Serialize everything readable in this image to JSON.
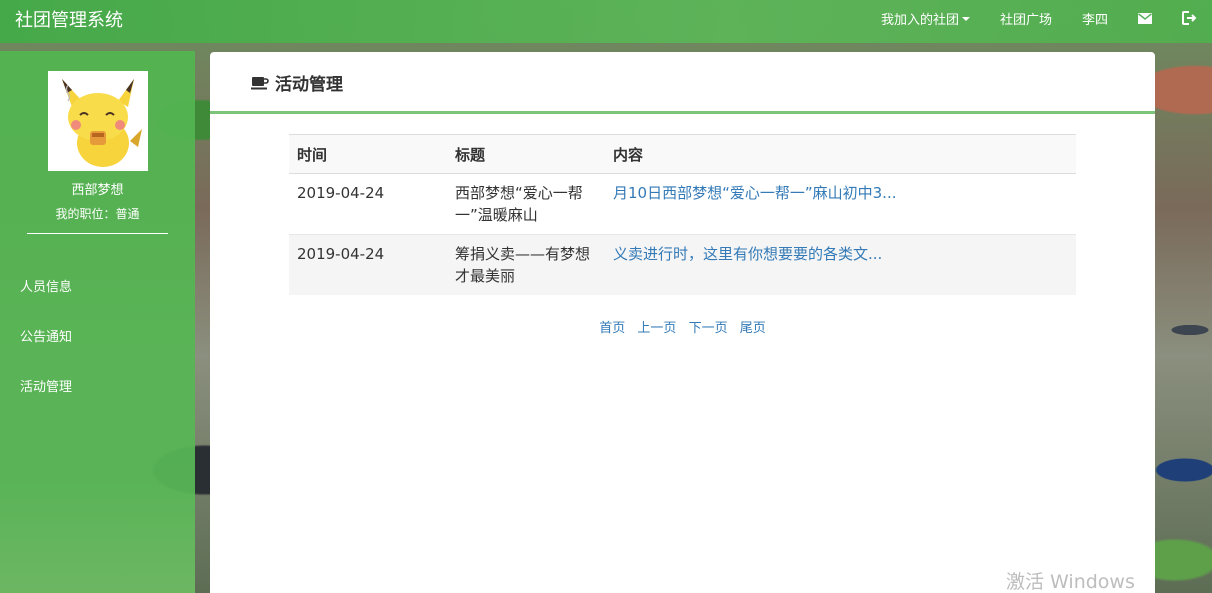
{
  "app": {
    "title": "社团管理系统"
  },
  "topnav": {
    "my_clubs_label": "我加入的社团",
    "club_square_label": "社团广场",
    "user_name": "李四",
    "mail_icon": "envelope-icon",
    "logout_icon": "logout-icon"
  },
  "sidebar": {
    "profile_name": "西部梦想",
    "profile_role": "我的职位：普通",
    "items": [
      {
        "label": "人员信息"
      },
      {
        "label": "公告通知"
      },
      {
        "label": "活动管理"
      }
    ]
  },
  "main": {
    "title": "活动管理",
    "title_icon": "coffee-cup-icon",
    "table": {
      "headers": [
        "时间",
        "标题",
        "内容"
      ],
      "rows": [
        {
          "time": "2019-04-24",
          "title": "西部梦想“爱心一帮一”温暖麻山",
          "content": "月10日西部梦想“爱心一帮一”麻山初中3..."
        },
        {
          "time": "2019-04-24",
          "title": "筹捐义卖——有梦想才最美丽",
          "content": "义卖进行时，这里有你想要要的各类文..."
        }
      ]
    },
    "pager": {
      "first": "首页",
      "prev": "上一页",
      "next": "下一页",
      "last": "尾页"
    }
  },
  "watermark": "激活 Windows",
  "colors": {
    "accent_green": "#4caf50",
    "link_blue": "#337ab7",
    "heading_border": "#7bc47a"
  }
}
